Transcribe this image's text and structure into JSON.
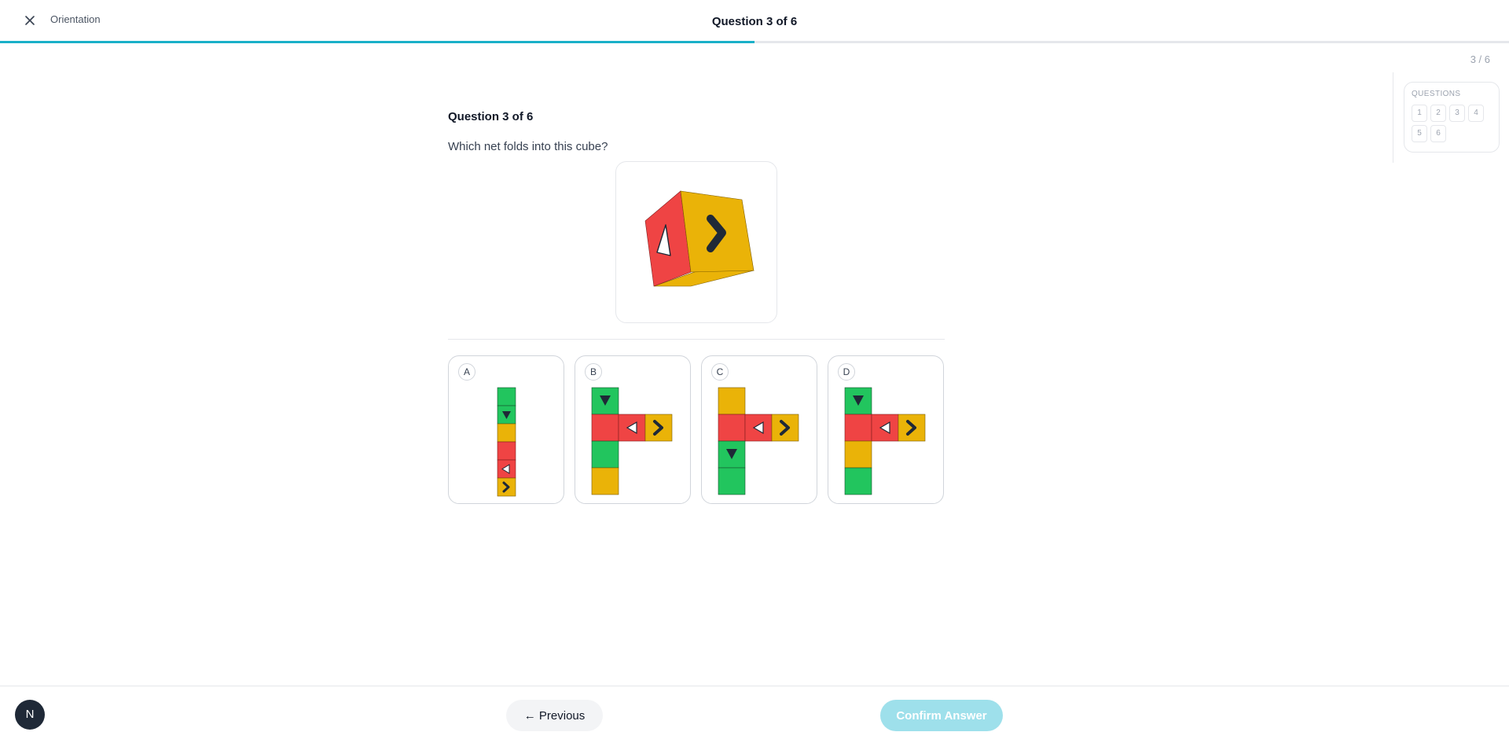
{
  "header": {
    "section": "Orientation",
    "title": "Question 3 of 6",
    "progress": 0.5
  },
  "counter": "3 / 6",
  "questions_panel": {
    "title": "QUESTIONS",
    "items": [
      "1",
      "2",
      "3",
      "4",
      "5",
      "6"
    ]
  },
  "question": {
    "heading": "Question 3 of 6",
    "prompt": "Which net folds into this cube?",
    "options": [
      {
        "letter": "A"
      },
      {
        "letter": "B"
      },
      {
        "letter": "C"
      },
      {
        "letter": "D"
      }
    ]
  },
  "footer": {
    "avatar": "N",
    "previous_label": "← Previous",
    "confirm_label": "Confirm Answer"
  },
  "colors": {
    "accent": "#1ab0c8",
    "red": "#ef4444",
    "yellow": "#eab308",
    "green": "#22c55e"
  }
}
